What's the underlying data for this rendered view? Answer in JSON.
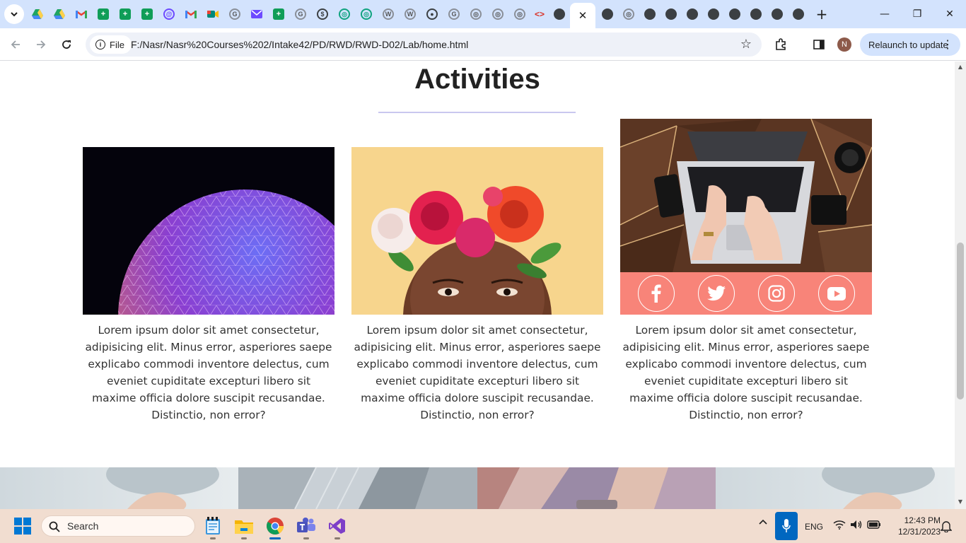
{
  "browser": {
    "tab_close_glyph": "✕",
    "new_tab_glyph": "+",
    "tab_icons": [
      "google-drive-icon",
      "google-drive-icon",
      "gmail-icon",
      "sheets-icon",
      "sheets-icon",
      "sheets-icon",
      "sheets-icon",
      "gmail-icon",
      "google-meet-icon",
      "google-icon",
      "proton-mail-icon",
      "sheets-icon",
      "google-icon",
      "dollar-icon",
      "chatgpt-icon",
      "chatgpt-icon",
      "wordpress-icon",
      "wordpress-icon",
      "circle-icon",
      "google-icon",
      "chatgpt-icon",
      "chatgpt-icon",
      "chatgpt-icon",
      "code-icon",
      "chrome-icon",
      "chrome-icon",
      "chatgpt-icon",
      "chrome-icon",
      "chrome-icon",
      "chrome-icon",
      "chrome-icon",
      "chrome-icon",
      "chrome-icon",
      "chrome-icon"
    ],
    "window_controls": {
      "minimize": "—",
      "maximize": "❐",
      "close": "✕"
    }
  },
  "toolbar": {
    "chip_label": "File",
    "url": "F:/Nasr/Nasr%20Courses%202/Intake42/PD/RWD/RWD-D02/Lab/home.html",
    "avatar_letter": "N",
    "relaunch_label": "Relaunch to update"
  },
  "page": {
    "heading": "Activities",
    "cards": [
      {
        "image": "geodesic-sphere",
        "text": "Lorem ipsum dolor sit amet consectetur, adipisicing elit. Minus error, asperiores saepe explicabo commodi inventore delectus, cum eveniet cupiditate excepturi libero sit maxime officia dolore suscipit recusandae. Distinctio, non error?"
      },
      {
        "image": "flower-crown-portrait",
        "text": "Lorem ipsum dolor sit amet consectetur, adipisicing elit. Minus error, asperiores saepe explicabo commodi inventore delectus, cum eveniet cupiditate excepturi libero sit maxime officia dolore suscipit recusandae. Distinctio, non error?"
      },
      {
        "image": "laptop-on-desk",
        "text": "Lorem ipsum dolor sit amet consectetur, adipisicing elit. Minus error, asperiores saepe explicabo commodi inventore delectus, cum eveniet cupiditate excepturi libero sit maxime officia dolore suscipit recusandae. Distinctio, non error?",
        "social": [
          "facebook-icon",
          "twitter-icon",
          "instagram-icon",
          "youtube-icon"
        ]
      }
    ],
    "social_bar_color": "#f88479"
  },
  "taskbar": {
    "search_placeholder": "Search",
    "language": "ENG",
    "time": "12:43 PM",
    "date": "12/31/2023"
  },
  "colors": {
    "tabstrip": "#d3e3fd",
    "taskbar": "#f1ddd0",
    "accent": "#0067c0"
  }
}
